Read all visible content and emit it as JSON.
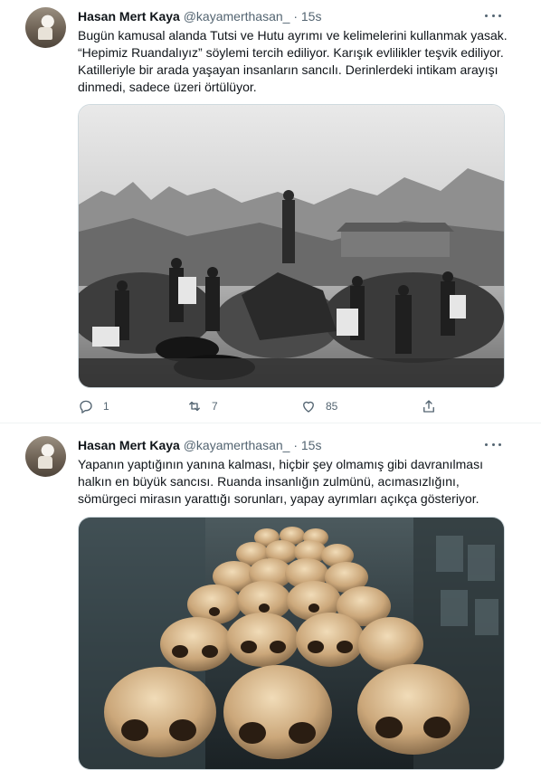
{
  "tweets": [
    {
      "author_name": "Hasan Mert Kaya",
      "handle": "@kayamerthasan_",
      "separator": "·",
      "time": "15s",
      "paragraphs": [
        "Bugün kamusal alanda Tutsi ve Hutu ayrımı ve kelimelerini kullanmak yasak. “Hepimiz Ruandalıyız” söylemi tercih ediliyor. Karışık evlilikler teşvik ediliyor. Katilleriyle bir arada yaşayan insanların sancılı. Derinlerdeki intikam arayışı dinmedi, sadece üzeri örtülüyor."
      ],
      "media_icon": "black-and-white-crowd-photo",
      "reply_count": "1",
      "retweet_count": "7",
      "like_count": "85"
    },
    {
      "author_name": "Hasan Mert Kaya",
      "handle": "@kayamerthasan_",
      "separator": "·",
      "time": "15s",
      "paragraphs": [
        "Yapanın yaptığının yanına kalması, hiçbir şey olmamış gibi davranılması halkın en büyük sancısı. Ruanda insanlığın zulmünü, acımasızlığını, sömürgeci mirasın yarattığı sorunları, yapay ayrımları açıkça gösteriyor."
      ],
      "media_icon": "skulls-memorial-photo"
    }
  ],
  "colors": {
    "text_primary": "#0f1419",
    "text_secondary": "#536471",
    "border": "#cfd9de"
  }
}
